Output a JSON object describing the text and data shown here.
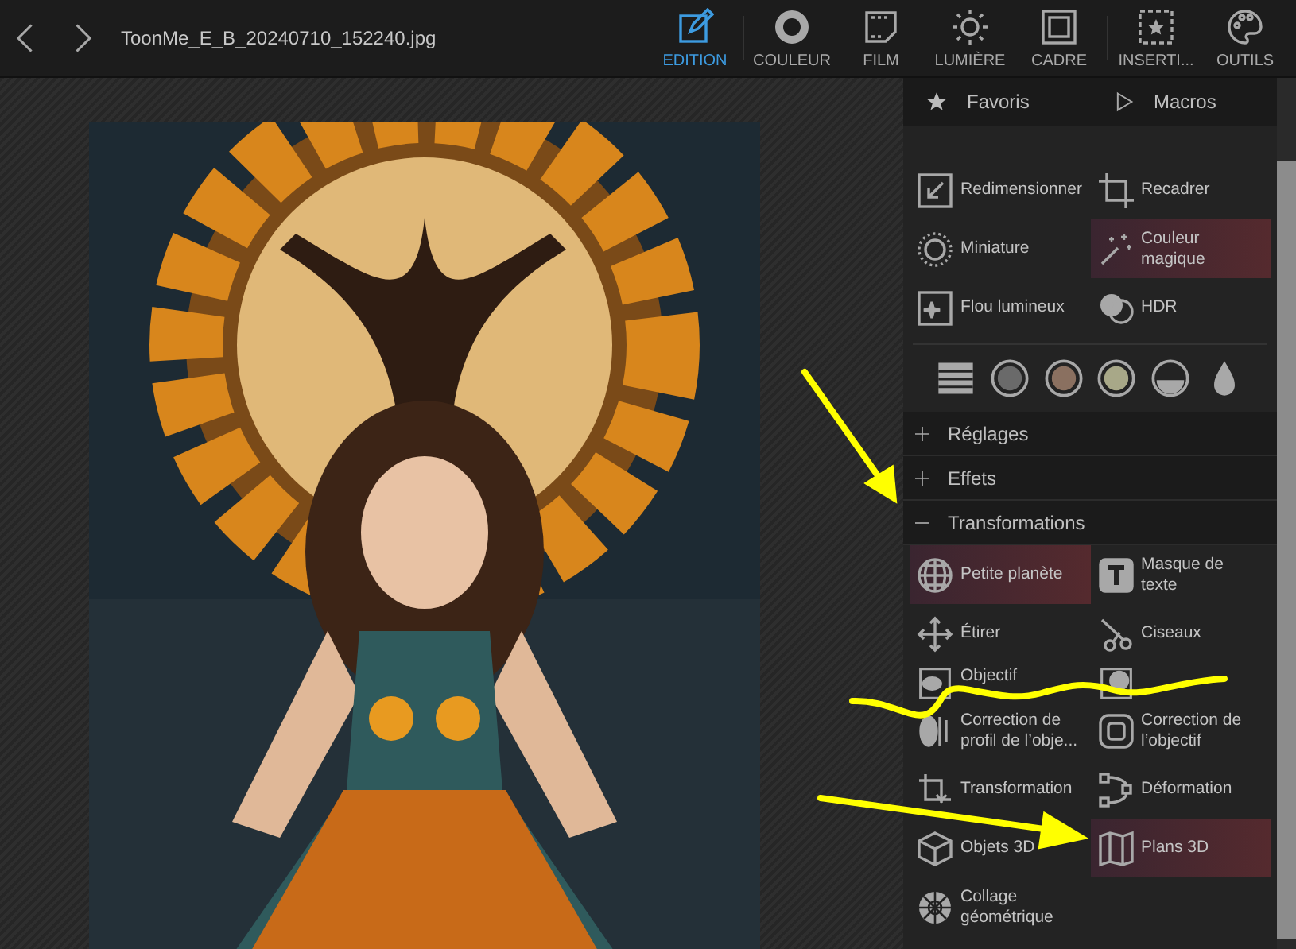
{
  "topbar": {
    "filename": "ToonMe_E_B_20240710_152240.jpg"
  },
  "toolbar": [
    {
      "label": "EDITION",
      "selected": true
    },
    {
      "label": "COULEUR",
      "selected": false
    },
    {
      "label": "FILM",
      "selected": false
    },
    {
      "label": "LUMIÈRE",
      "selected": false
    },
    {
      "label": "CADRE",
      "selected": false
    },
    {
      "label": "INSERTI...",
      "selected": false
    },
    {
      "label": "OUTILS",
      "selected": false
    }
  ],
  "panel": {
    "tabs": [
      "Favoris",
      "Macros"
    ],
    "tools": [
      {
        "label": "Redimensionner",
        "selected": false
      },
      {
        "label": "Recadrer",
        "selected": false
      },
      {
        "label": "Miniature",
        "selected": false
      },
      {
        "label": "Couleur\nmagique",
        "selected": true
      },
      {
        "label": "Flou lumineux",
        "selected": false
      },
      {
        "label": "HDR",
        "selected": false
      }
    ],
    "sections": [
      {
        "label": "Réglages",
        "expanded": false
      },
      {
        "label": "Effets",
        "expanded": false
      },
      {
        "label": "Transformations",
        "expanded": true,
        "tools": [
          {
            "label": "Petite planète",
            "selected": true
          },
          {
            "label": "Masque de\ntexte",
            "selected": false
          },
          {
            "label": "Étirer",
            "selected": false
          },
          {
            "label": "Ciseaux",
            "selected": false
          },
          {
            "label": "Objectif",
            "selected": false
          },
          {
            "selected": false
          },
          {
            "label": "Correction de\nprofil de l’obje...",
            "selected": false
          },
          {
            "label": "Correction de\nl’objectif",
            "selected": false
          },
          {
            "label": "Transformation",
            "selected": false
          },
          {
            "label": "Déformation",
            "selected": false
          },
          {
            "label": "Objets 3D",
            "selected": false
          },
          {
            "label": "Plans 3D",
            "selected": true
          },
          {
            "label": "Collage\ngéométrique",
            "selected": false
          }
        ]
      }
    ]
  }
}
